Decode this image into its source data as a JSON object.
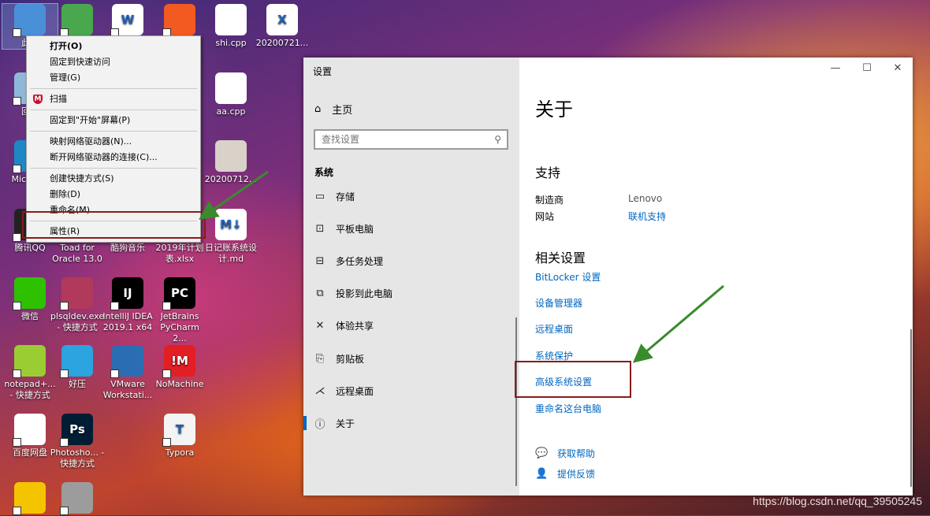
{
  "desktop": {
    "icons": [
      {
        "label": "此电",
        "icon": "computer-icon",
        "bg": "#4a90d9"
      },
      {
        "label": "",
        "icon": "spring-app-icon",
        "bg": "#49a84d"
      },
      {
        "label": "",
        "icon": "word-doc-icon",
        "bg": "#ffffff",
        "glyph": "W"
      },
      {
        "label": "",
        "icon": "paint-app-icon",
        "bg": "#f25a22"
      },
      {
        "label": "shi.cpp",
        "icon": "file-icon",
        "bg": "#ffffff"
      },
      {
        "label": "20200721...",
        "icon": "excel-file-icon",
        "bg": "#ffffff",
        "glyph": "X"
      },
      {
        "label": "回收",
        "icon": "recycle-bin-icon",
        "bg": "#8fb8d8"
      },
      {
        "label": "aa.cpp",
        "icon": "file-icon",
        "bg": "#ffffff"
      },
      {
        "label": "Micro Ed",
        "icon": "edge-browser-icon",
        "bg": "#1e88c7"
      },
      {
        "label": "20200712...",
        "icon": "image-file-icon",
        "bg": "#d8d2c8"
      },
      {
        "label": "腾讯QQ",
        "icon": "qq-icon",
        "bg": "#222222"
      },
      {
        "label": "Toad for Oracle 13.0",
        "icon": "toad-icon",
        "bg": "#2a6e3a"
      },
      {
        "label": "酷狗音乐",
        "icon": "kugou-icon",
        "bg": "#1a7de0"
      },
      {
        "label": "2019年计划表.xlsx",
        "icon": "excel-file-icon",
        "bg": "#1d7044"
      },
      {
        "label": "日记账系统设计.md",
        "icon": "markdown-file-icon",
        "bg": "#ffffff",
        "glyph": "M↓"
      },
      {
        "label": "微信",
        "icon": "wechat-icon",
        "bg": "#2dc100"
      },
      {
        "label": "plsqldev.exe - 快捷方式",
        "icon": "plsql-icon",
        "bg": "#b13a5a"
      },
      {
        "label": "IntelliJ IDEA 2019.1 x64",
        "icon": "intellij-icon",
        "bg": "#000000",
        "glyph": "IJ"
      },
      {
        "label": "JetBrains PyCharm 2...",
        "icon": "pycharm-icon",
        "bg": "#000000",
        "glyph": "PC"
      },
      {
        "label": "notepad+... - 快捷方式",
        "icon": "notepad-plus-icon",
        "bg": "#9acd32"
      },
      {
        "label": "好压",
        "icon": "haozip-icon",
        "bg": "#2ba4e0"
      },
      {
        "label": "VMware Workstati...",
        "icon": "vmware-icon",
        "bg": "#2a6db2"
      },
      {
        "label": "NoMachine",
        "icon": "nomachine-icon",
        "bg": "#e31e24",
        "glyph": "!M"
      },
      {
        "label": "百度网盘",
        "icon": "baidu-netdisk-icon",
        "bg": "#ffffff"
      },
      {
        "label": "Photosho... - 快捷方式",
        "icon": "photoshop-icon",
        "bg": "#001d34",
        "glyph": "Ps"
      },
      {
        "label": "Typora",
        "icon": "typora-icon",
        "bg": "#f4f4f4",
        "glyph": "T"
      },
      {
        "label": "",
        "icon": "player-icon",
        "bg": "#f5c400"
      },
      {
        "label": "",
        "icon": "dvd-icon",
        "bg": "#9c9c9c"
      }
    ]
  },
  "context_menu": {
    "items": {
      "open": "打开(O)",
      "pin_quick": "固定到快速访问",
      "manage": "管理(G)",
      "scan": "扫描",
      "pin_start": "固定到\"开始\"屏幕(P)",
      "map_drive": "映射网络驱动器(N)...",
      "disconnect_drive": "断开网络驱动器的连接(C)...",
      "create_shortcut": "创建快捷方式(S)",
      "delete": "删除(D)",
      "rename": "重命名(M)",
      "properties": "属性(R)"
    }
  },
  "settings": {
    "window_title": "设置",
    "controls": {
      "minimize": "—",
      "maximize": "☐",
      "close": "✕"
    },
    "sidebar": {
      "home": "主页",
      "search_placeholder": "查找设置",
      "category": "系统",
      "items": [
        {
          "label": "存储",
          "icon": "storage-icon",
          "glyph": "▭"
        },
        {
          "label": "平板电脑",
          "icon": "tablet-icon",
          "glyph": "⊡"
        },
        {
          "label": "多任务处理",
          "icon": "multitasking-icon",
          "glyph": "⊟"
        },
        {
          "label": "投影到此电脑",
          "icon": "project-icon",
          "glyph": "⧉"
        },
        {
          "label": "体验共享",
          "icon": "shared-experiences-icon",
          "glyph": "✕"
        },
        {
          "label": "剪贴板",
          "icon": "clipboard-icon",
          "glyph": "⎘"
        },
        {
          "label": "远程桌面",
          "icon": "remote-desktop-icon",
          "glyph": "⋌"
        },
        {
          "label": "关于",
          "icon": "info-icon",
          "glyph": "ⓘ",
          "active": true
        }
      ]
    },
    "main": {
      "title": "关于",
      "support": {
        "heading": "支持",
        "manufacturer_label": "制造商",
        "manufacturer_value": "Lenovo",
        "website_label": "网站",
        "website_value": "联机支持"
      },
      "related": {
        "heading": "相关设置",
        "links": [
          "BitLocker 设置",
          "设备管理器",
          "远程桌面",
          "系统保护",
          "高级系统设置",
          "重命名这台电脑"
        ]
      },
      "help": {
        "get_help": "获取帮助",
        "feedback": "提供反馈"
      }
    }
  },
  "colors": {
    "accent": "#0067c0",
    "highlight_box": "#8b1a1a",
    "arrow": "#3a8a2e"
  },
  "watermark": "https://blog.csdn.net/qq_39505245"
}
